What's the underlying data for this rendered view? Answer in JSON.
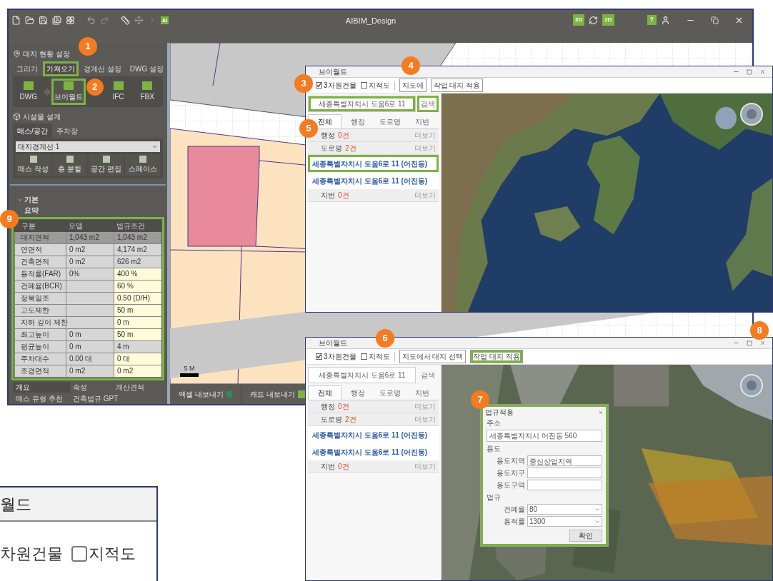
{
  "app": {
    "logo": "AI",
    "title": "AIBIM_Design",
    "view_badges": [
      "3D",
      "2D"
    ],
    "help": "?"
  },
  "site_panel": {
    "title": "대지 현황 설정",
    "tabs": [
      {
        "label": "그리기",
        "selected": false,
        "highlighted": false
      },
      {
        "label": "가져오기",
        "selected": true,
        "highlighted": true
      },
      {
        "label": "경계선 설정",
        "selected": false,
        "highlighted": false
      },
      {
        "label": "DWG 설정",
        "selected": false,
        "highlighted": false
      }
    ],
    "imports": [
      {
        "label": "DWG",
        "highlighted": false
      },
      {
        "label": "브이월드",
        "highlighted": true
      },
      {
        "label": "IFC",
        "highlighted": false
      },
      {
        "label": "FBX",
        "highlighted": false
      }
    ]
  },
  "facility_panel": {
    "title": "시설물 설계",
    "tabs": [
      {
        "label": "매스/공간",
        "selected": true
      },
      {
        "label": "주차장",
        "selected": false
      }
    ],
    "boundary": "대지경계선 1",
    "tools": [
      "매스 작성",
      "층 분할",
      "공간 편집",
      "스페이스"
    ]
  },
  "properties": {
    "group": {
      "label": "기본",
      "expanded": true
    },
    "subgroup": "요약"
  },
  "summary_table": {
    "highlighted": true,
    "columns": [
      "구분",
      "모델",
      "법규조건"
    ],
    "rows": [
      {
        "cells": [
          "대지면적",
          "1,043 m2",
          "1,043 m2"
        ],
        "selected": true,
        "editable": false
      },
      {
        "cells": [
          "연면적",
          "0 m2",
          "4,174 m2"
        ],
        "selected": false,
        "editable": false
      },
      {
        "cells": [
          "건축면적",
          "0 m2",
          "626 m2"
        ],
        "selected": false,
        "editable": false
      },
      {
        "cells": [
          "용적률(FAR)",
          "0%",
          "400 %"
        ],
        "selected": false,
        "editable": true
      },
      {
        "cells": [
          "건폐율(BCR)",
          "",
          "60 %"
        ],
        "selected": false,
        "editable": true
      },
      {
        "cells": [
          "정북일조",
          "",
          "0.50 (D/H)"
        ],
        "selected": false,
        "editable": true
      },
      {
        "cells": [
          "고도제한",
          "",
          "50 m"
        ],
        "selected": false,
        "editable": true
      },
      {
        "cells": [
          "지하 깊이 제한",
          "",
          "0 m"
        ],
        "selected": false,
        "editable": true
      },
      {
        "cells": [
          "최고높이",
          "0 m",
          "50 m"
        ],
        "selected": false,
        "editable": true
      },
      {
        "cells": [
          "평균높이",
          "0 m",
          "4 m"
        ],
        "selected": false,
        "editable": false
      },
      {
        "cells": [
          "주차대수",
          "0.00 대",
          "0 대"
        ],
        "selected": false,
        "editable": true
      },
      {
        "cells": [
          "조경면적",
          "0 m2",
          "0 m2"
        ],
        "selected": false,
        "editable": true
      }
    ]
  },
  "bottom_tabs": [
    {
      "label": "개요",
      "selected": true
    },
    {
      "label": "속성",
      "selected": false
    },
    {
      "label": "개산견적",
      "selected": false
    },
    {
      "label": "매스 유형 추천",
      "selected": false
    },
    {
      "label": "건축법규 GPT",
      "selected": false
    }
  ],
  "canvas": {
    "scale": "5 M",
    "exports": [
      {
        "label": "엑셀 내보내기",
        "kind": "excel"
      },
      {
        "label": "캐드 내보내기",
        "kind": "dwg"
      }
    ]
  },
  "vworld_windows": [
    {
      "title": "브이월드",
      "options": [
        {
          "label": "3차원건물",
          "checked": true
        },
        {
          "label": "지적도",
          "checked": false
        }
      ],
      "actions": [
        {
          "label": "지도에",
          "highlighted": false
        },
        {
          "label": "작업 대지 적용",
          "highlighted": false
        }
      ],
      "search": {
        "value": "세종특별자치시 도움6로 11",
        "highlighted": true
      },
      "search_button": {
        "label": "검색",
        "highlighted": true
      },
      "tabs": [
        {
          "label": "전체",
          "selected": true
        },
        {
          "label": "행정",
          "selected": false
        },
        {
          "label": "도로명",
          "selected": false
        },
        {
          "label": "지번",
          "selected": false
        }
      ],
      "results": [
        {
          "kind": "group",
          "label": "행정",
          "count": "0건",
          "more": "더보기"
        },
        {
          "kind": "group",
          "label": "도로명",
          "count": "2건",
          "more": "더보기"
        },
        {
          "kind": "item",
          "label": "세종특별자치시 도움6로 11 (어진동)",
          "highlighted": true
        },
        {
          "kind": "item",
          "label": "세종특별자치시 도움6로 11 (어진동)",
          "highlighted": false
        },
        {
          "kind": "group",
          "label": "지번",
          "count": "0건",
          "more": "더보기"
        }
      ],
      "map": {
        "kind": "country"
      }
    },
    {
      "title": "브이월드",
      "options": [
        {
          "label": "3차원건물",
          "checked": true
        },
        {
          "label": "지적도",
          "checked": false
        }
      ],
      "actions": [
        {
          "label": "지도에서 대지 선택",
          "highlighted": false
        },
        {
          "label": "작업 대지 적용",
          "highlighted": true
        }
      ],
      "search": {
        "value": "세종특별자치시 도움6로 11",
        "highlighted": false
      },
      "search_button": {
        "label": "검색",
        "highlighted": false
      },
      "tabs": [
        {
          "label": "전체",
          "selected": true
        },
        {
          "label": "행정",
          "selected": false
        },
        {
          "label": "도로명",
          "selected": false
        },
        {
          "label": "지번",
          "selected": false
        }
      ],
      "results": [
        {
          "kind": "group",
          "label": "행정",
          "count": "0건",
          "more": "더보기"
        },
        {
          "kind": "group",
          "label": "도로명",
          "count": "2건",
          "more": "더보기"
        },
        {
          "kind": "item",
          "label": "세종특별자치시 도움6로 11 (어진동)",
          "highlighted": false
        },
        {
          "kind": "item",
          "label": "세종특별자치시 도움6로 11 (어진동)",
          "highlighted": false
        },
        {
          "kind": "group",
          "label": "지번",
          "count": "0건",
          "more": "더보기"
        }
      ],
      "map": {
        "kind": "city"
      }
    }
  ],
  "law_dialog": {
    "title": "법규적용",
    "highlighted": true,
    "address_label": "주소",
    "address": "세종특별자치시 어진동 560",
    "use_label": "용도",
    "use_fields": [
      {
        "label": "용도지역",
        "value": "중심상업지역"
      },
      {
        "label": "용도지구"
      },
      {
        "label": "용도구역"
      }
    ],
    "law_label": "법규",
    "law_fields": [
      {
        "label": "건폐율",
        "value": "80"
      },
      {
        "label": "용적률",
        "value": "1300"
      }
    ],
    "ok": "확인"
  },
  "inset": {
    "title": "월드",
    "label": "차원건물",
    "option": {
      "label": "지적도",
      "checked": false
    }
  },
  "callouts": [
    "1",
    "2",
    "3",
    "4",
    "5",
    "6",
    "7",
    "8",
    "9"
  ]
}
